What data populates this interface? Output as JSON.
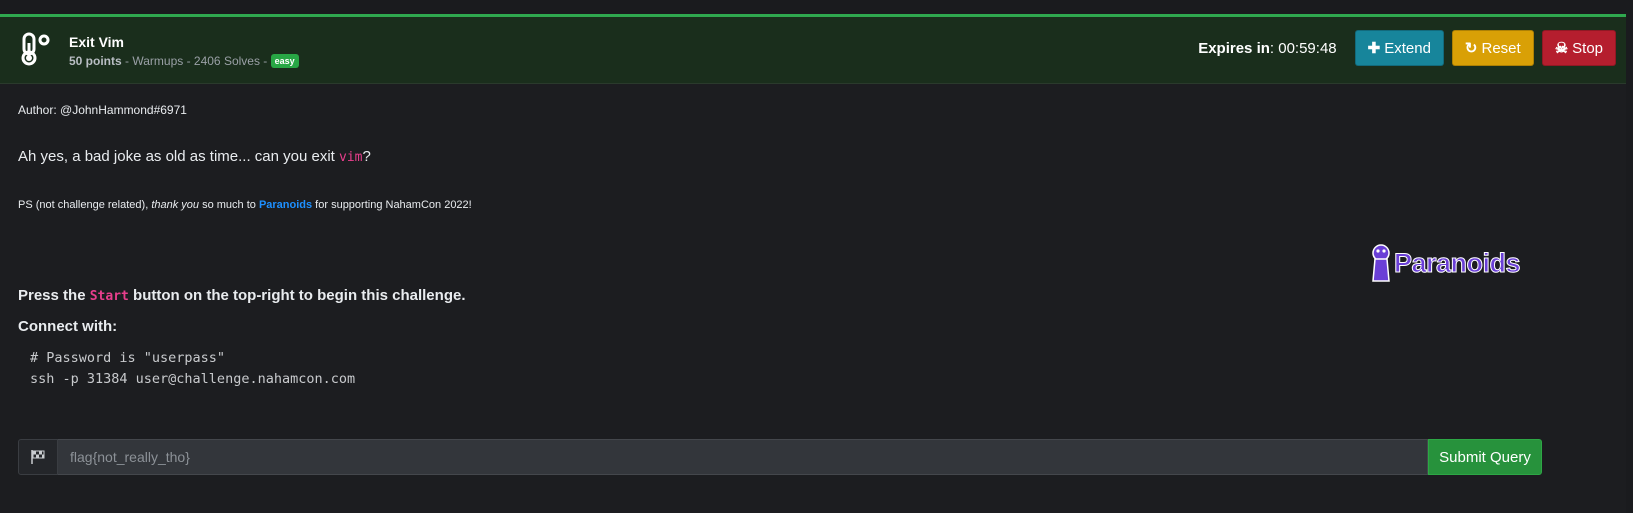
{
  "challenge": {
    "title": "Exit Vim",
    "points": "50 points",
    "meta_rest": " - Warmups - 2406 Solves - ",
    "difficulty": "easy"
  },
  "header": {
    "expires_label": "Expires in",
    "expires_value": ": 00:59:48",
    "buttons": {
      "extend": "Extend",
      "reset": "Reset",
      "stop": "Stop"
    }
  },
  "description": {
    "author": "Author: @JohnHammond#6971",
    "lead_pre": "Ah yes, a bad joke as old as time... can you exit ",
    "lead_code": "vim",
    "lead_post": "?",
    "ps_pre": "PS (not challenge related), ",
    "ps_em": "thank you",
    "ps_mid": " so much to ",
    "ps_link": "Paranoids",
    "ps_post": " for supporting NahamCon 2022!",
    "logo_text": "Paranoids",
    "press_pre": "Press the ",
    "press_code": "Start",
    "press_post": " button on the top-right to begin this challenge.",
    "connect": "Connect with:",
    "code_line1": "# Password is \"userpass\"",
    "code_line2": "ssh -p 31384 user@challenge.nahamcon.com"
  },
  "flag_form": {
    "placeholder": "flag{not_really_tho}",
    "submit": "Submit Query"
  },
  "colors": {
    "header_bg": "#1a2e1c",
    "accent_green": "#2fa84f",
    "extend": "#17859b",
    "reset": "#d9a006",
    "stop": "#b51e2e",
    "code_pink": "#e83e8c",
    "link": "#1e90ff",
    "logo": "#6a3fd6"
  }
}
